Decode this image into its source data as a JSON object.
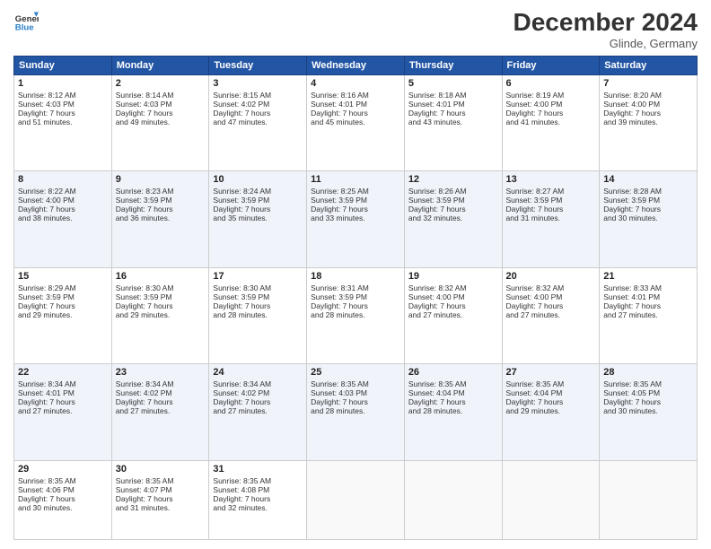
{
  "header": {
    "logo_line1": "General",
    "logo_line2": "Blue",
    "month_title": "December 2024",
    "location": "Glinde, Germany"
  },
  "weekdays": [
    "Sunday",
    "Monday",
    "Tuesday",
    "Wednesday",
    "Thursday",
    "Friday",
    "Saturday"
  ],
  "weeks": [
    [
      {
        "day": "1",
        "lines": [
          "Sunrise: 8:12 AM",
          "Sunset: 4:03 PM",
          "Daylight: 7 hours",
          "and 51 minutes."
        ]
      },
      {
        "day": "2",
        "lines": [
          "Sunrise: 8:14 AM",
          "Sunset: 4:03 PM",
          "Daylight: 7 hours",
          "and 49 minutes."
        ]
      },
      {
        "day": "3",
        "lines": [
          "Sunrise: 8:15 AM",
          "Sunset: 4:02 PM",
          "Daylight: 7 hours",
          "and 47 minutes."
        ]
      },
      {
        "day": "4",
        "lines": [
          "Sunrise: 8:16 AM",
          "Sunset: 4:01 PM",
          "Daylight: 7 hours",
          "and 45 minutes."
        ]
      },
      {
        "day": "5",
        "lines": [
          "Sunrise: 8:18 AM",
          "Sunset: 4:01 PM",
          "Daylight: 7 hours",
          "and 43 minutes."
        ]
      },
      {
        "day": "6",
        "lines": [
          "Sunrise: 8:19 AM",
          "Sunset: 4:00 PM",
          "Daylight: 7 hours",
          "and 41 minutes."
        ]
      },
      {
        "day": "7",
        "lines": [
          "Sunrise: 8:20 AM",
          "Sunset: 4:00 PM",
          "Daylight: 7 hours",
          "and 39 minutes."
        ]
      }
    ],
    [
      {
        "day": "8",
        "lines": [
          "Sunrise: 8:22 AM",
          "Sunset: 4:00 PM",
          "Daylight: 7 hours",
          "and 38 minutes."
        ]
      },
      {
        "day": "9",
        "lines": [
          "Sunrise: 8:23 AM",
          "Sunset: 3:59 PM",
          "Daylight: 7 hours",
          "and 36 minutes."
        ]
      },
      {
        "day": "10",
        "lines": [
          "Sunrise: 8:24 AM",
          "Sunset: 3:59 PM",
          "Daylight: 7 hours",
          "and 35 minutes."
        ]
      },
      {
        "day": "11",
        "lines": [
          "Sunrise: 8:25 AM",
          "Sunset: 3:59 PM",
          "Daylight: 7 hours",
          "and 33 minutes."
        ]
      },
      {
        "day": "12",
        "lines": [
          "Sunrise: 8:26 AM",
          "Sunset: 3:59 PM",
          "Daylight: 7 hours",
          "and 32 minutes."
        ]
      },
      {
        "day": "13",
        "lines": [
          "Sunrise: 8:27 AM",
          "Sunset: 3:59 PM",
          "Daylight: 7 hours",
          "and 31 minutes."
        ]
      },
      {
        "day": "14",
        "lines": [
          "Sunrise: 8:28 AM",
          "Sunset: 3:59 PM",
          "Daylight: 7 hours",
          "and 30 minutes."
        ]
      }
    ],
    [
      {
        "day": "15",
        "lines": [
          "Sunrise: 8:29 AM",
          "Sunset: 3:59 PM",
          "Daylight: 7 hours",
          "and 29 minutes."
        ]
      },
      {
        "day": "16",
        "lines": [
          "Sunrise: 8:30 AM",
          "Sunset: 3:59 PM",
          "Daylight: 7 hours",
          "and 29 minutes."
        ]
      },
      {
        "day": "17",
        "lines": [
          "Sunrise: 8:30 AM",
          "Sunset: 3:59 PM",
          "Daylight: 7 hours",
          "and 28 minutes."
        ]
      },
      {
        "day": "18",
        "lines": [
          "Sunrise: 8:31 AM",
          "Sunset: 3:59 PM",
          "Daylight: 7 hours",
          "and 28 minutes."
        ]
      },
      {
        "day": "19",
        "lines": [
          "Sunrise: 8:32 AM",
          "Sunset: 4:00 PM",
          "Daylight: 7 hours",
          "and 27 minutes."
        ]
      },
      {
        "day": "20",
        "lines": [
          "Sunrise: 8:32 AM",
          "Sunset: 4:00 PM",
          "Daylight: 7 hours",
          "and 27 minutes."
        ]
      },
      {
        "day": "21",
        "lines": [
          "Sunrise: 8:33 AM",
          "Sunset: 4:01 PM",
          "Daylight: 7 hours",
          "and 27 minutes."
        ]
      }
    ],
    [
      {
        "day": "22",
        "lines": [
          "Sunrise: 8:34 AM",
          "Sunset: 4:01 PM",
          "Daylight: 7 hours",
          "and 27 minutes."
        ]
      },
      {
        "day": "23",
        "lines": [
          "Sunrise: 8:34 AM",
          "Sunset: 4:02 PM",
          "Daylight: 7 hours",
          "and 27 minutes."
        ]
      },
      {
        "day": "24",
        "lines": [
          "Sunrise: 8:34 AM",
          "Sunset: 4:02 PM",
          "Daylight: 7 hours",
          "and 27 minutes."
        ]
      },
      {
        "day": "25",
        "lines": [
          "Sunrise: 8:35 AM",
          "Sunset: 4:03 PM",
          "Daylight: 7 hours",
          "and 28 minutes."
        ]
      },
      {
        "day": "26",
        "lines": [
          "Sunrise: 8:35 AM",
          "Sunset: 4:04 PM",
          "Daylight: 7 hours",
          "and 28 minutes."
        ]
      },
      {
        "day": "27",
        "lines": [
          "Sunrise: 8:35 AM",
          "Sunset: 4:04 PM",
          "Daylight: 7 hours",
          "and 29 minutes."
        ]
      },
      {
        "day": "28",
        "lines": [
          "Sunrise: 8:35 AM",
          "Sunset: 4:05 PM",
          "Daylight: 7 hours",
          "and 30 minutes."
        ]
      }
    ],
    [
      {
        "day": "29",
        "lines": [
          "Sunrise: 8:35 AM",
          "Sunset: 4:06 PM",
          "Daylight: 7 hours",
          "and 30 minutes."
        ]
      },
      {
        "day": "30",
        "lines": [
          "Sunrise: 8:35 AM",
          "Sunset: 4:07 PM",
          "Daylight: 7 hours",
          "and 31 minutes."
        ]
      },
      {
        "day": "31",
        "lines": [
          "Sunrise: 8:35 AM",
          "Sunset: 4:08 PM",
          "Daylight: 7 hours",
          "and 32 minutes."
        ]
      },
      null,
      null,
      null,
      null
    ]
  ]
}
